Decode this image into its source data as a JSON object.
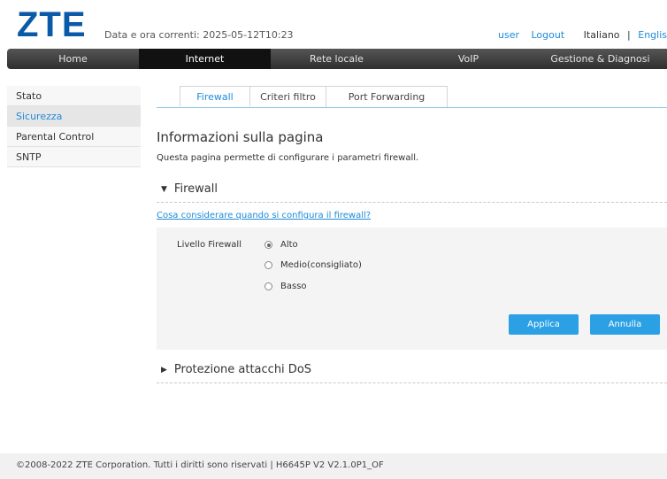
{
  "header": {
    "logo_text": "ZTE",
    "datetime": "Data e ora correnti: 2025-05-12T10:23",
    "user": "user",
    "logout": "Logout",
    "lang_current": "Italiano",
    "separator": "|",
    "lang_other": "Englis"
  },
  "nav": {
    "items": [
      {
        "label": "Home"
      },
      {
        "label": "Internet"
      },
      {
        "label": "Rete locale"
      },
      {
        "label": "VoIP"
      },
      {
        "label": "Gestione & Diagnosi"
      }
    ],
    "active": "Internet"
  },
  "sidebar": {
    "items": [
      {
        "label": "Stato"
      },
      {
        "label": "Sicurezza"
      },
      {
        "label": "Parental Control"
      },
      {
        "label": "SNTP"
      }
    ],
    "active": "Sicurezza"
  },
  "tabs": {
    "items": [
      {
        "label": "Firewall"
      },
      {
        "label": "Criteri filtro"
      },
      {
        "label": "Port Forwarding"
      }
    ],
    "active": "Firewall"
  },
  "page": {
    "title": "Informazioni sulla pagina",
    "description": "Questa pagina permette di configurare i parametri firewall."
  },
  "firewall_section": {
    "title": "Firewall",
    "arrow": "▼",
    "help_link": "Cosa considerare quando si configura il firewall?",
    "level_label": "Livello Firewall",
    "options": [
      {
        "label": "Alto",
        "checked": true
      },
      {
        "label": "Medio(consigliato)",
        "checked": false
      },
      {
        "label": "Basso",
        "checked": false
      }
    ],
    "apply_label": "Applica",
    "cancel_label": "Annulla"
  },
  "dos_section": {
    "title": "Protezione attacchi DoS",
    "arrow": "▶"
  },
  "footer": {
    "text": "©2008-2022 ZTE Corporation. Tutti i diritti sono riservati  |   H6645P V2 V2.1.0P1_OF"
  },
  "colors": {
    "brand": "#0a5aa8",
    "accent": "#2ca0e4",
    "link": "#1c8ad8"
  }
}
